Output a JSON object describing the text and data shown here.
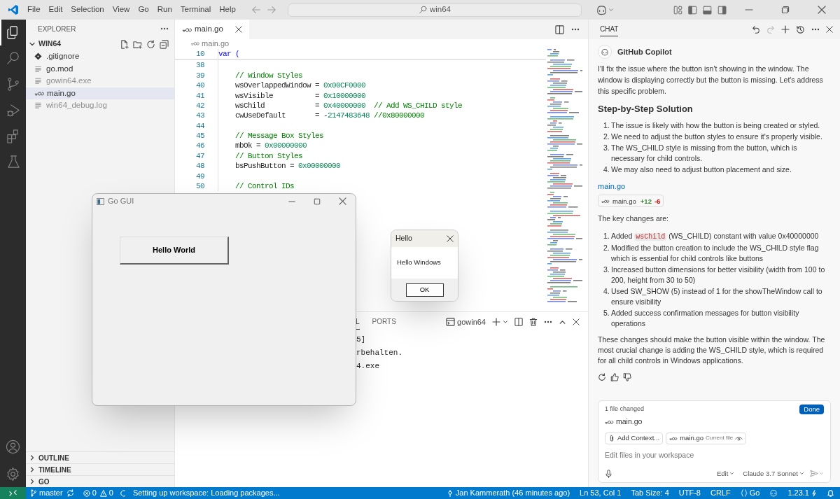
{
  "title_bar": {
    "menu": [
      "File",
      "Edit",
      "Selection",
      "View",
      "Go",
      "Run",
      "Terminal",
      "Help"
    ],
    "search": "win64"
  },
  "activity_bar": {
    "top": [
      {
        "selected": true
      },
      {
        "selected": false
      },
      {
        "selected": false
      },
      {
        "selected": false
      },
      {
        "selected": false
      },
      {
        "selected": false
      }
    ]
  },
  "explorer": {
    "title": "EXPLORER",
    "folder": {
      "name": "WIN64",
      "expanded": true,
      "children": [
        {
          "name": ".gitignore",
          "kind": "git",
          "selected": false,
          "ignored": false
        },
        {
          "name": "go.mod",
          "kind": "text",
          "selected": false,
          "ignored": false
        },
        {
          "name": "gowin64.exe",
          "kind": "text",
          "selected": false,
          "ignored": true
        },
        {
          "name": "main.go",
          "kind": "go",
          "selected": true,
          "ignored": false
        },
        {
          "name": "win64_debug.log",
          "kind": "text",
          "selected": false,
          "ignored": true
        }
      ]
    },
    "sections": [
      {
        "name": "OUTLINE",
        "expanded": false
      },
      {
        "name": "TIMELINE",
        "expanded": false
      },
      {
        "name": "GO",
        "expanded": false
      }
    ]
  },
  "editor": {
    "tab": {
      "label": "main.go",
      "selected": true
    },
    "breadcrumb": "main.go",
    "sticky_line": {
      "number": "10",
      "tokens": [
        {
          "kind": "keyword",
          "text": "var"
        },
        {
          "kind": "keyword",
          "text": " ("
        }
      ]
    },
    "lines": [
      {
        "number": "38"
      },
      {
        "number": "39",
        "tokens": [
          {
            "kind": "comment",
            "text": "    // Window Styles"
          }
        ]
      },
      {
        "number": "40",
        "tokens": [
          {
            "kind": "plain",
            "text": "    wsOverlappedWindow = "
          },
          {
            "kind": "number",
            "text": "0x00CF0000"
          }
        ]
      },
      {
        "number": "41",
        "tokens": [
          {
            "kind": "plain",
            "text": "    wsVisible          = "
          },
          {
            "kind": "number",
            "text": "0x10000000"
          }
        ]
      },
      {
        "number": "42",
        "tokens": [
          {
            "kind": "plain",
            "text": "    wsChild            = "
          },
          {
            "kind": "number",
            "text": "0x40000000"
          },
          {
            "kind": "comment",
            "text": "  // Add WS_CHILD style"
          }
        ]
      },
      {
        "number": "43",
        "tokens": [
          {
            "kind": "plain",
            "text": "    cwUseDefault       = -"
          },
          {
            "kind": "number",
            "text": "2147483648"
          },
          {
            "kind": "comment",
            "text": " //0x80000000"
          }
        ]
      },
      {
        "number": "44"
      },
      {
        "number": "45",
        "tokens": [
          {
            "kind": "comment",
            "text": "    // Message Box Styles"
          }
        ]
      },
      {
        "number": "46",
        "tokens": [
          {
            "kind": "plain",
            "text": "    mbOk = "
          },
          {
            "kind": "number",
            "text": "0x00000000"
          }
        ]
      },
      {
        "number": "47",
        "tokens": [
          {
            "kind": "comment",
            "text": "    // Button Styles"
          }
        ]
      },
      {
        "number": "48",
        "tokens": [
          {
            "kind": "plain",
            "text": "    bsPushButton = "
          },
          {
            "kind": "number",
            "text": "0x00000000"
          }
        ]
      },
      {
        "number": "49"
      },
      {
        "number": "50",
        "tokens": [
          {
            "kind": "comment",
            "text": "    // Control IDs"
          }
        ]
      }
    ]
  },
  "panel": {
    "tabs": [
      {
        "label": "L",
        "selected": true
      },
      {
        "label": "PORTS",
        "selected": false
      }
    ],
    "terminal_name": "gowin64",
    "lines": [
      {
        "text": "5]"
      },
      {
        "text": "rbehalten."
      },
      {
        "text": "4.exe"
      }
    ]
  },
  "gui_window": {
    "title": "Go GUI",
    "button": "Hello World"
  },
  "dialog": {
    "title": "Hello",
    "message": "Hello Windows",
    "button": "OK"
  },
  "chat": {
    "header": "CHAT",
    "author": "GitHub Copilot",
    "intro": "I'll fix the issue where the button isn't showing in the window. The window is displaying correctly but the button is missing. Let's address this specific problem.",
    "heading": "Step-by-Step Solution",
    "steps": [
      {
        "number": "1.",
        "text": "The issue is likely with how the button is being created or styled."
      },
      {
        "number": "2.",
        "text": "We need to adjust the button styles to ensure it's properly visible."
      },
      {
        "number": "3.",
        "text": "The WS_CHILD style is missing from the button, which is necessary for child controls."
      },
      {
        "number": "4.",
        "text": "We may also need to adjust button placement and size."
      }
    ],
    "file_link": "main.go",
    "file_chip": {
      "name": "main.go",
      "added": "+12",
      "removed": "-6"
    },
    "changes_intro": "The key changes are:",
    "changes": [
      {
        "number": "1.",
        "text": "Added",
        "code": "wsChild",
        "text_after": "(WS_CHILD) constant with value 0x40000000"
      },
      {
        "number": "2.",
        "text": "Modified the button creation to include the WS_CHILD style flag which is essential for child controls like buttons"
      },
      {
        "number": "3.",
        "text": "Increased button dimensions for better visibility (width from 100 to 200, height from 30 to 50)"
      },
      {
        "number": "4.",
        "text": "Used SW_SHOW (5) instead of 1 for the showTheWindow call to ensure visibility"
      },
      {
        "number": "5.",
        "text": "Added success confirmation messages for button visibility operations"
      }
    ],
    "summary": "These changes should make the button visible within the window. The most crucial change is adding the WS_CHILD style, which is required for all child controls in Windows applications.",
    "input": {
      "files_changed": "1 file changed",
      "done": "Done",
      "file": "main.go",
      "add_context": "Add Context...",
      "context_file": "main.go",
      "context_note": "Current file",
      "placeholder": "Edit files in your workspace",
      "mode": "Edit",
      "model": "Claude 3.7 Sonnet"
    }
  },
  "status_bar": {
    "branch": "master",
    "errors": "0",
    "warnings": "0",
    "progress": "Setting up workspace: Loading packages...",
    "blame": "Jan Kammerath (46 minutes ago)",
    "position": "Ln 53, Col 1",
    "tab_size": "Tab Size: 4",
    "encoding": "UTF-8",
    "eol": "CRLF",
    "language": "Go",
    "version": "1.23.1"
  }
}
